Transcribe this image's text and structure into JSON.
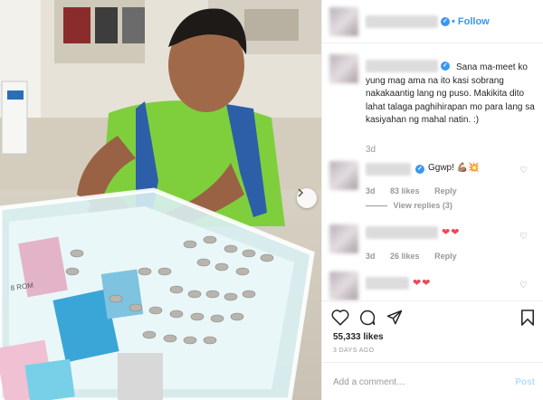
{
  "post": {
    "follow_label": "• Follow",
    "caption": "Sana ma-meet ko yung mag ama na ito kasi sobrang nakakaantig lang ng puso. Makikita dito lahat talaga paghihirapan mo para lang sa kasiyahan ng mahal natin. :)",
    "caption_time": "3d",
    "verified_mark": "✓",
    "likes": "55,333 likes",
    "date": "3 DAYS AGO"
  },
  "comments": [
    {
      "text": "Ggwp! 💪🏽💥",
      "time": "3d",
      "likes": "83 likes",
      "reply": "Reply",
      "view_replies": "View replies (3)"
    },
    {
      "text": "❤❤",
      "time": "3d",
      "likes": "26 likes",
      "reply": "Reply"
    },
    {
      "text": "❤❤"
    }
  ],
  "input": {
    "placeholder": "Add a comment…",
    "post_label": "Post"
  },
  "icons": [
    "chevron-right-icon",
    "verified-icon",
    "heart-icon",
    "comment-icon",
    "share-icon",
    "bookmark-icon"
  ],
  "colors": {
    "link_blue": "#3897f0",
    "heart_red": "#ed4956",
    "muted": "#999999"
  },
  "photo": {
    "coin_stacks_visible": true,
    "phone_box_label": "8 ROM"
  }
}
